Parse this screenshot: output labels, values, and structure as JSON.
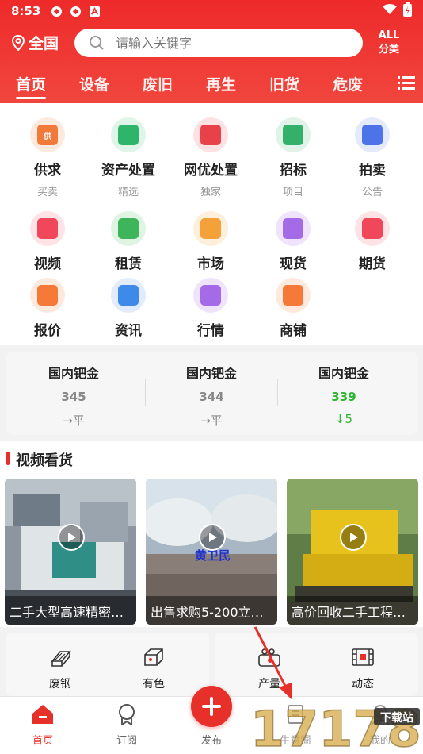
{
  "status_bar": {
    "time": "8:53"
  },
  "search": {
    "location": "全国",
    "placeholder": "请输入关键字",
    "all_line1": "ALL",
    "all_line2": "分类"
  },
  "tabs": [
    "首页",
    "设备",
    "废旧",
    "再生",
    "旧货",
    "危废"
  ],
  "grid": [
    {
      "label": "供求",
      "sub": "买卖",
      "icon": "supply-icon",
      "color": "#f07a3a",
      "bg": "#fde9de",
      "glyph": "供"
    },
    {
      "label": "资产处置",
      "sub": "精选",
      "icon": "asset-icon",
      "color": "#2fb56b",
      "bg": "#dff5e8",
      "glyph": ""
    },
    {
      "label": "网优处置",
      "sub": "独家",
      "icon": "disposal-icon",
      "color": "#e8414a",
      "bg": "#fde1e3",
      "glyph": ""
    },
    {
      "label": "招标",
      "sub": "项目",
      "icon": "tender-icon",
      "color": "#35b06a",
      "bg": "#dff3e8",
      "glyph": ""
    },
    {
      "label": "拍卖",
      "sub": "公告",
      "icon": "auction-icon",
      "color": "#4d73e8",
      "bg": "#e3eafc",
      "glyph": ""
    },
    {
      "label": "视频",
      "sub": "",
      "icon": "video-icon",
      "color": "#f0475b",
      "bg": "#fde3e6",
      "glyph": ""
    },
    {
      "label": "租赁",
      "sub": "",
      "icon": "lease-icon",
      "color": "#3eb55a",
      "bg": "#e0f4e4",
      "glyph": ""
    },
    {
      "label": "市场",
      "sub": "",
      "icon": "market-icon",
      "color": "#f5a13a",
      "bg": "#fdefdc",
      "glyph": ""
    },
    {
      "label": "现货",
      "sub": "",
      "icon": "spot-icon",
      "color": "#a46ae8",
      "bg": "#efe4fc",
      "glyph": ""
    },
    {
      "label": "期货",
      "sub": "",
      "icon": "futures-icon",
      "color": "#f0475b",
      "bg": "#fde3e6",
      "glyph": ""
    },
    {
      "label": "报价",
      "sub": "",
      "icon": "quote-icon",
      "color": "#f57a3a",
      "bg": "#fde9de",
      "glyph": ""
    },
    {
      "label": "资讯",
      "sub": "",
      "icon": "news-icon",
      "color": "#3d8ae8",
      "bg": "#e2ecfc",
      "glyph": ""
    },
    {
      "label": "行情",
      "sub": "",
      "icon": "trend-icon",
      "color": "#a46ae8",
      "bg": "#efe4fc",
      "glyph": ""
    },
    {
      "label": "商铺",
      "sub": "",
      "icon": "shop-icon",
      "color": "#f57a3a",
      "bg": "#fde9de",
      "glyph": ""
    }
  ],
  "prices": [
    {
      "name": "国内钯金",
      "value": "345",
      "change": "→平",
      "trend": "flat"
    },
    {
      "name": "国内钯金",
      "value": "344",
      "change": "→平",
      "trend": "flat"
    },
    {
      "name": "国内钯金",
      "value": "339",
      "change": "↓5",
      "trend": "down"
    }
  ],
  "videos": {
    "title": "视频看货",
    "items": [
      {
        "caption": "二手大型高速精密…"
      },
      {
        "caption": "出售求购5-200立…",
        "overlay": "黄卫民"
      },
      {
        "caption": "高价回收二手工程…"
      }
    ]
  },
  "categories": [
    "废钢",
    "有色",
    "产量",
    "动态"
  ],
  "bottom_nav": [
    "首页",
    "订阅",
    "发布",
    "生意圈",
    "我的"
  ],
  "watermark": "17178"
}
